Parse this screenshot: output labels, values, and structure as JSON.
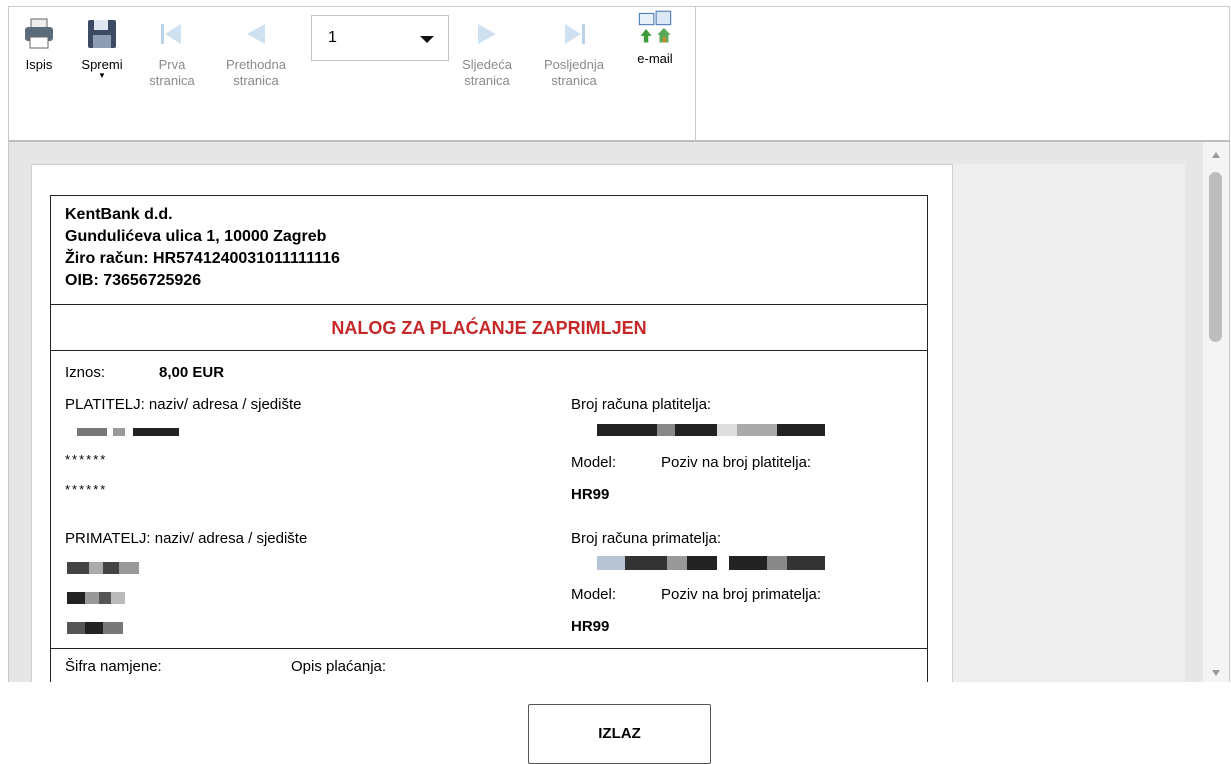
{
  "toolbar": {
    "print": "Ispis",
    "save": "Spremi",
    "first_page_1": "Prva",
    "first_page_2": "stranica",
    "prev_page_1": "Prethodna",
    "prev_page_2": "stranica",
    "page_number": "1",
    "next_page_1": "Sljedeća",
    "next_page_2": "stranica",
    "last_page_1": "Posljednja",
    "last_page_2": "stranica",
    "email": "e-mail"
  },
  "document": {
    "bank_name": "KentBank d.d.",
    "bank_address": "Gundulićeva ulica 1, 10000 Zagreb",
    "bank_account": "Žiro račun: HR5741240031011111116",
    "bank_oib": "OIB: 73656725926",
    "title": "NALOG ZA PLAĆANJE ZAPRIMLJEN",
    "amount_label": "Iznos:",
    "amount_value": "8,00 EUR",
    "payer_label": "PLATITELJ: naziv/ adresa / sjedište",
    "payer_line2": "******",
    "payer_line3": "******",
    "payer_account_label": "Broj računa platitelja:",
    "payer_model_label": "Model:",
    "payer_ref_label": "Poziv na broj platitelja:",
    "payer_model_value": "HR99",
    "payee_label": "PRIMATELJ: naziv/ adresa / sjedište",
    "payee_account_label": "Broj računa primatelja:",
    "payee_model_label": "Model:",
    "payee_ref_label": "Poziv na broj primatelja:",
    "payee_model_value": "HR99",
    "purpose_code_label": "Šifra namjene:",
    "description_label": "Opis plaćanja:"
  },
  "exit_button": "IZLAZ",
  "colors": {
    "title_red": "#c62828",
    "disabled_icon": "#b9d3ea",
    "accent": "#3a6fb0"
  }
}
